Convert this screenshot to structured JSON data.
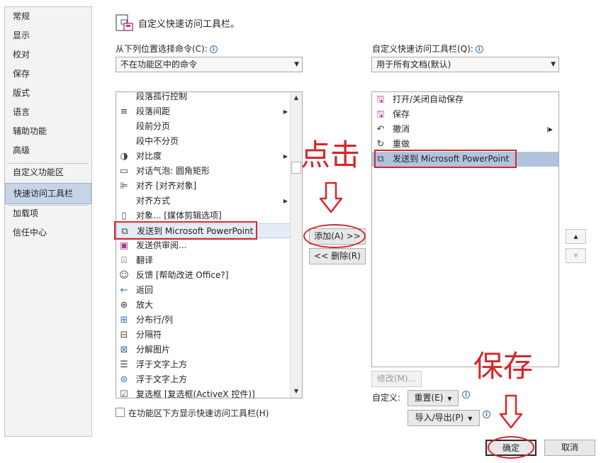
{
  "nav": {
    "items": [
      "常规",
      "显示",
      "校对",
      "保存",
      "版式",
      "语言",
      "辅助功能",
      "高级",
      "自定义功能区",
      "快速访问工具栏",
      "加载项",
      "信任中心"
    ],
    "active_index": 9
  },
  "header": {
    "title": "自定义快速访问工具栏。",
    "icon": "customize-toolbar-icon"
  },
  "choose_from": {
    "label": "从下列位置选择命令(C):",
    "value": "不在功能区中的命令"
  },
  "customize_toolbar": {
    "label": "自定义快速访问工具栏(Q):",
    "value": "用于所有文档(默认)"
  },
  "commands": [
    {
      "label": "段落孤行控制",
      "icon": "none",
      "submenu": false
    },
    {
      "label": "段落间距",
      "icon": "paragraph-spacing-icon",
      "submenu": true
    },
    {
      "label": "段前分页",
      "icon": "none",
      "submenu": false
    },
    {
      "label": "段中不分页",
      "icon": "none",
      "submenu": false
    },
    {
      "label": "对比度",
      "icon": "contrast-icon",
      "submenu": true
    },
    {
      "label": "对话气泡: 圆角矩形",
      "icon": "speech-bubble-icon",
      "submenu": false
    },
    {
      "label": "对齐 [对齐对象]",
      "icon": "align-icon",
      "submenu": false
    },
    {
      "label": "对齐方式",
      "icon": "none",
      "submenu": true
    },
    {
      "label": "对象... [媒体剪辑选项]",
      "icon": "object-icon",
      "submenu": false
    },
    {
      "label": "发送到 Microsoft PowerPoint",
      "icon": "send-to-powerpoint-icon",
      "submenu": false
    },
    {
      "label": "发送供审阅...",
      "icon": "send-review-icon",
      "submenu": false
    },
    {
      "label": "翻译",
      "icon": "translate-icon",
      "submenu": false
    },
    {
      "label": "反馈 [帮助改进 Office?]",
      "icon": "feedback-icon",
      "submenu": false
    },
    {
      "label": "返回",
      "icon": "back-arrow-icon",
      "submenu": false
    },
    {
      "label": "放大",
      "icon": "zoom-in-icon",
      "submenu": false
    },
    {
      "label": "分布行/列",
      "icon": "distribute-rows-icon",
      "submenu": false
    },
    {
      "label": "分隔符",
      "icon": "separator-icon",
      "submenu": false
    },
    {
      "label": "分解图片",
      "icon": "ungroup-picture-icon",
      "submenu": false
    },
    {
      "label": "浮于文字上方",
      "icon": "bring-front-text-icon",
      "submenu": false
    },
    {
      "label": "浮于文字上方",
      "icon": "wrap-front-icon",
      "submenu": false
    },
    {
      "label": "复选框 [复选框(ActiveX 控件)]",
      "icon": "checkbox-icon",
      "submenu": false
    }
  ],
  "commands_selected_index": 9,
  "toolbar_items": [
    {
      "label": "打开/关闭自动保存",
      "icon": "autosave-icon"
    },
    {
      "label": "保存",
      "icon": "save-icon"
    },
    {
      "label": "撤消",
      "icon": "undo-icon",
      "submenu": true
    },
    {
      "label": "重做",
      "icon": "redo-icon"
    },
    {
      "label": "发送到 Microsoft PowerPoint",
      "icon": "send-to-powerpoint-icon"
    }
  ],
  "toolbar_selected_index": 4,
  "buttons": {
    "add": "添加(A) >>",
    "remove": "<< 删除(R)",
    "modify": "修改(M)...",
    "customizations_label": "自定义:",
    "reset": "重置(E)",
    "import_export": "导入/导出(P)",
    "ok": "确定",
    "cancel": "取消"
  },
  "show_below_ribbon": {
    "label": "在功能区下方显示快速访问工具栏(H)",
    "checked": false
  },
  "annotations": {
    "click": "点击",
    "save": "保存"
  },
  "colors": {
    "annotation_red": "#d8262b",
    "nav_active": "#c5d4e6",
    "list_selected": "#b0c4de"
  }
}
